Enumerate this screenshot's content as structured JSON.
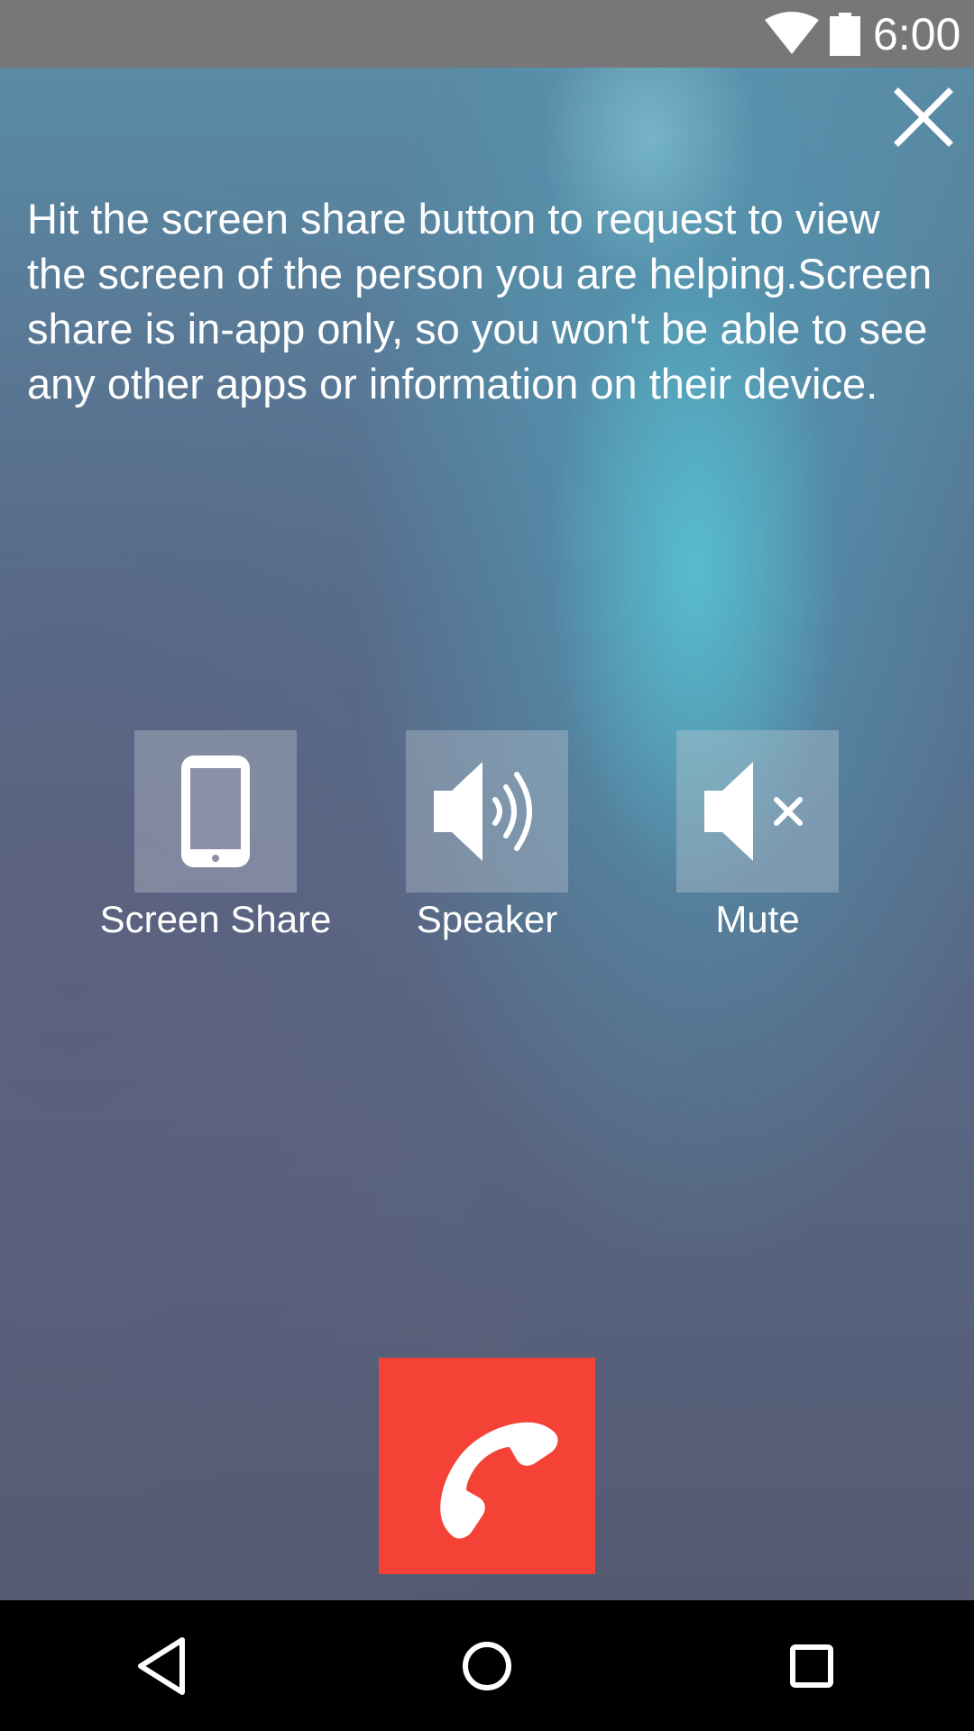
{
  "status_bar": {
    "time": "6:00",
    "icons": [
      "wifi-icon",
      "battery-icon"
    ]
  },
  "close_icon": "close-icon",
  "instruction": "Hit the screen share button to request to view the screen of the person you are helping.Screen share is in-app only, so you won't be able to see any other apps or information on their device.",
  "controls": [
    {
      "label": "Screen Share",
      "icon": "smartphone-icon"
    },
    {
      "label": "Speaker",
      "icon": "speaker-icon"
    },
    {
      "label": "Mute",
      "icon": "mute-icon"
    }
  ],
  "end_call": {
    "icon": "end-call-icon"
  },
  "navigation": {
    "icons": [
      "back-icon",
      "home-icon",
      "recents-icon"
    ]
  },
  "colors": {
    "end_call": "#f44336",
    "status_bar": "#777777",
    "nav_bar": "#000000",
    "text": "#ffffff"
  }
}
